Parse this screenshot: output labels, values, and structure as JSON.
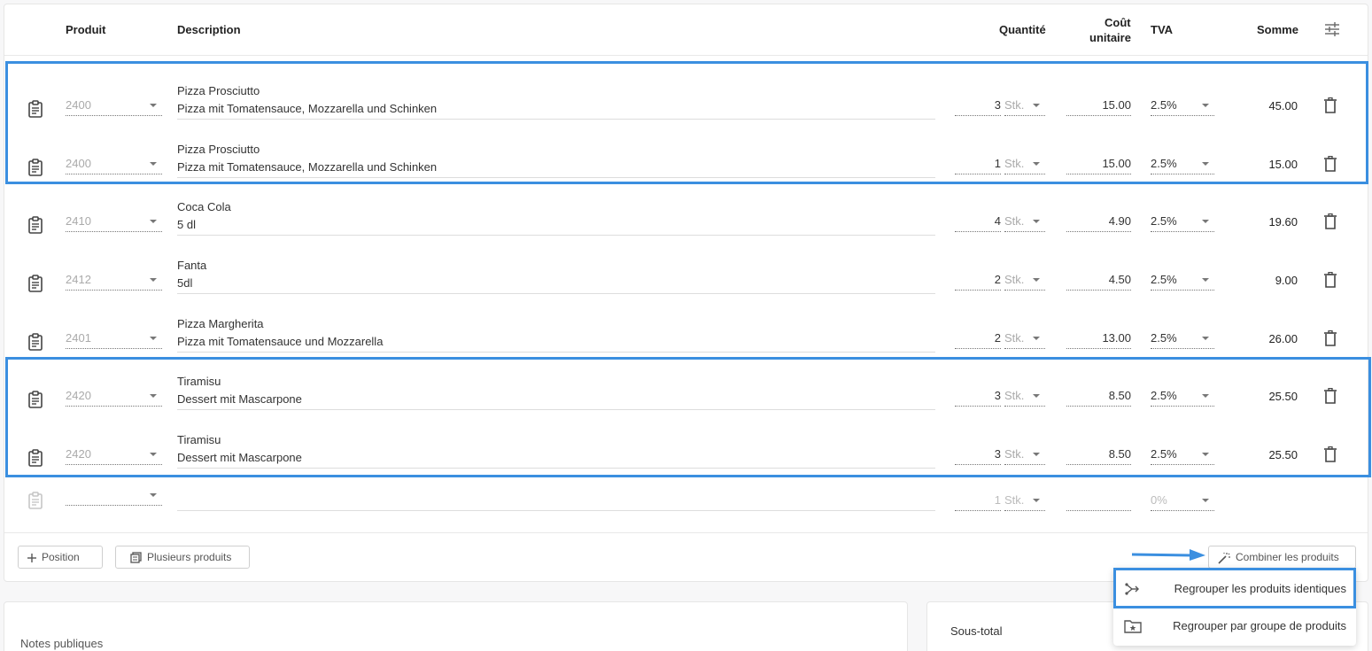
{
  "headers": {
    "product": "Produit",
    "description": "Description",
    "quantity": "Quantité",
    "unit_cost_1": "Coût",
    "unit_cost_2": "unitaire",
    "vat": "TVA",
    "sum": "Somme"
  },
  "rows": [
    {
      "code": "2400",
      "name": "Pizza Prosciutto",
      "desc": "Pizza mit Tomatensauce, Mozzarella und Schinken",
      "qty": "3",
      "unit": "Stk.",
      "price": "15.00",
      "vat": "2.5%",
      "sum": "45.00"
    },
    {
      "code": "2400",
      "name": "Pizza Prosciutto",
      "desc": "Pizza mit Tomatensauce, Mozzarella und Schinken",
      "qty": "1",
      "unit": "Stk.",
      "price": "15.00",
      "vat": "2.5%",
      "sum": "15.00"
    },
    {
      "code": "2410",
      "name": "Coca Cola",
      "desc": "5 dl",
      "qty": "4",
      "unit": "Stk.",
      "price": "4.90",
      "vat": "2.5%",
      "sum": "19.60"
    },
    {
      "code": "2412",
      "name": "Fanta",
      "desc": "5dl",
      "qty": "2",
      "unit": "Stk.",
      "price": "4.50",
      "vat": "2.5%",
      "sum": "9.00"
    },
    {
      "code": "2401",
      "name": "Pizza Margherita",
      "desc": "Pizza mit Tomatensauce und Mozzarella",
      "qty": "2",
      "unit": "Stk.",
      "price": "13.00",
      "vat": "2.5%",
      "sum": "26.00"
    },
    {
      "code": "2420",
      "name": "Tiramisu",
      "desc": "Dessert mit Mascarpone",
      "qty": "3",
      "unit": "Stk.",
      "price": "8.50",
      "vat": "2.5%",
      "sum": "25.50"
    },
    {
      "code": "2420",
      "name": "Tiramisu",
      "desc": "Dessert mit Mascarpone",
      "qty": "3",
      "unit": "Stk.",
      "price": "8.50",
      "vat": "2.5%",
      "sum": "25.50"
    }
  ],
  "empty_row": {
    "qty": "1",
    "unit": "Stk.",
    "vat": "0%"
  },
  "buttons": {
    "add_position": "Position",
    "multiple_products": "Plusieurs produits",
    "combine_products": "Combiner les produits"
  },
  "dropdown": {
    "group_identical": "Regrouper les produits identiques",
    "group_by_product_group": "Regrouper par groupe de produits"
  },
  "notes_label": "Notes publiques",
  "subtotal_label": "Sous-total",
  "accent_color": "#3b8fe0"
}
